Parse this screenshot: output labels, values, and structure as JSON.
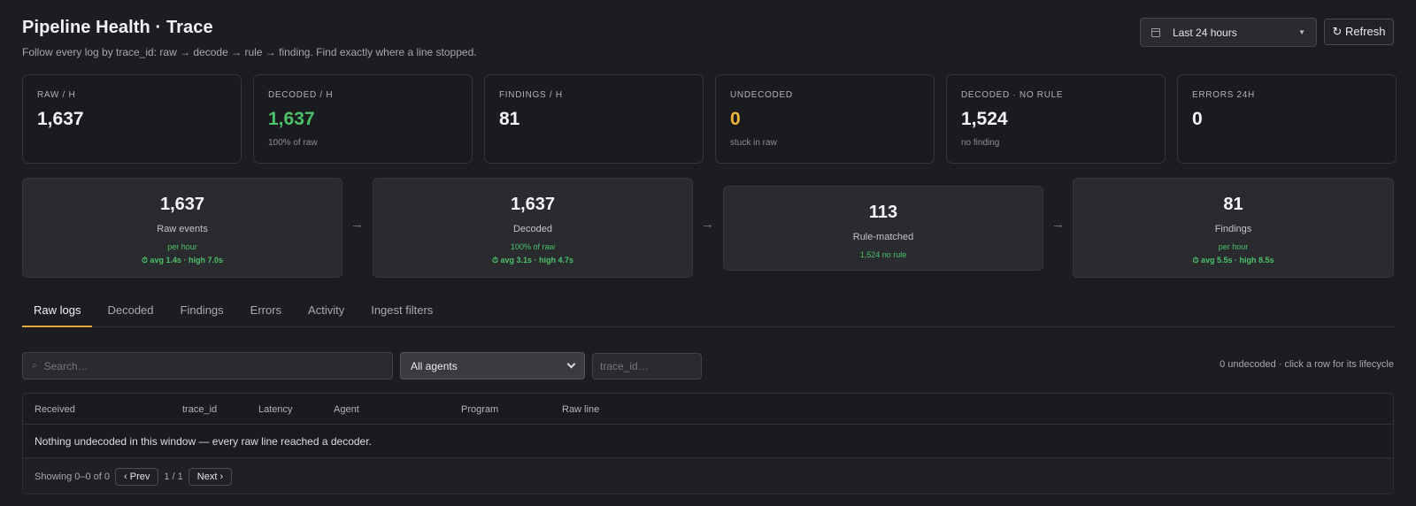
{
  "header": {
    "title": "Pipeline Health · Trace",
    "subtitle": "Follow every log by trace_id: raw → decode → rule → finding. Find exactly where a line stopped."
  },
  "controls": {
    "range_label": "Last 24 hours",
    "refresh_label": "↻ Refresh"
  },
  "stats": [
    {
      "label": "RAW / H",
      "value": "1,637",
      "sub": "",
      "color": "#f3f3f5"
    },
    {
      "label": "DECODED / H",
      "value": "1,637",
      "sub": "100% of raw",
      "color": "#4cc06a"
    },
    {
      "label": "FINDINGS / H",
      "value": "81",
      "sub": "",
      "color": "#f3f3f5"
    },
    {
      "label": "UNDECODED",
      "value": "0",
      "sub": "stuck in raw",
      "color": "#f0b43a"
    },
    {
      "label": "DECODED · NO RULE",
      "value": "1,524",
      "sub": "no finding",
      "color": "#f3f3f5"
    },
    {
      "label": "ERRORS 24H",
      "value": "0",
      "sub": "",
      "color": "#f3f3f5"
    }
  ],
  "flow": [
    {
      "value": "1,637",
      "label": "Raw events",
      "sub": "per hour",
      "timing": "⏱ avg 1.4s · high 7.0s"
    },
    {
      "value": "1,637",
      "label": "Decoded",
      "sub": "100% of raw",
      "timing": "⏱ avg 3.1s · high 4.7s"
    },
    {
      "value": "113",
      "label": "Rule-matched",
      "sub": "1,524 no rule",
      "timing": ""
    },
    {
      "value": "81",
      "label": "Findings",
      "sub": "per hour",
      "timing": "⏱ avg 5.5s · high 8.5s"
    }
  ],
  "flow_arrow": "→",
  "tabs": [
    "Raw logs",
    "Decoded",
    "Findings",
    "Errors",
    "Activity",
    "Ingest filters"
  ],
  "filters": {
    "search_placeholder": "Search…",
    "agent_selected": "All agents",
    "trace_placeholder": "trace_id…",
    "hint": "0 undecoded · click a row for its lifecycle"
  },
  "table": {
    "columns": [
      "Received",
      "trace_id",
      "Latency",
      "Agent",
      "Program",
      "Raw line"
    ],
    "empty_message": "Nothing undecoded in this window — every raw line reached a decoder."
  },
  "pager": {
    "showing": "Showing 0–0 of 0",
    "prev": "‹ Prev",
    "page": "1 / 1",
    "next": "Next ›"
  }
}
